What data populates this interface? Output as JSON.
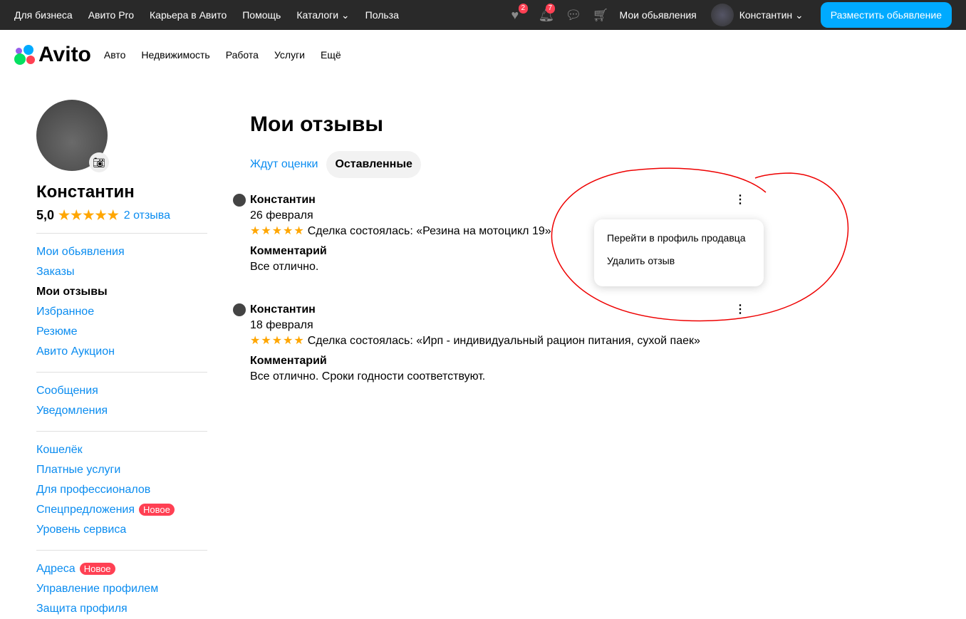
{
  "topbar": {
    "links": [
      "Для бизнеса",
      "Авито Pro",
      "Карьера в Авито",
      "Помощь",
      "Каталоги ⌄",
      "Польза"
    ],
    "fav_count": "2",
    "notif_count": "7",
    "my_ads": "Мои обьявления",
    "user": "Константин ⌄",
    "post_button": "Разместить обьявление"
  },
  "nav": {
    "logo": "Avito",
    "items": [
      "Авто",
      "Недвижимость",
      "Работа",
      "Услуги",
      "Ещё"
    ]
  },
  "profile": {
    "name": "Константин",
    "rating": "5,0",
    "stars": "★★★★★",
    "reviews_link": "2 отзыва"
  },
  "menu": {
    "g1": [
      "Мои обьявления",
      "Заказы",
      "Мои отзывы",
      "Избранное",
      "Резюме",
      "Авито Аукцион"
    ],
    "g2": [
      "Сообщения",
      "Уведомления"
    ],
    "g3": [
      "Кошелёк",
      "Платные услуги",
      "Для профессионалов",
      "Спецпредложения",
      "Уровень сервиса"
    ],
    "g4": [
      "Адреса",
      "Управление профилем",
      "Защита профиля"
    ],
    "new_badge": "Новое"
  },
  "main": {
    "title": "Мои отзывы",
    "tabs": [
      "Ждут оценки",
      "Оставленные"
    ],
    "reviews": [
      {
        "author": "Константин",
        "date": "26 февраля",
        "stars": "★★★★★",
        "deal": "Сделка состоялась: «Резина на мотоцикл 19»",
        "comment_label": "Комментарий",
        "comment": "Все отлично."
      },
      {
        "author": "Константин",
        "date": "18 февраля",
        "stars": "★★★★★",
        "deal": "Сделка состоялась: «Ирп - индивидуальный рацион питания, сухой паек»",
        "comment_label": "Комментарий",
        "comment": "Все отлично. Сроки годности соответствуют."
      }
    ]
  },
  "popup": {
    "items": [
      "Перейти в профиль продавца",
      "Удалить отзыв"
    ]
  }
}
